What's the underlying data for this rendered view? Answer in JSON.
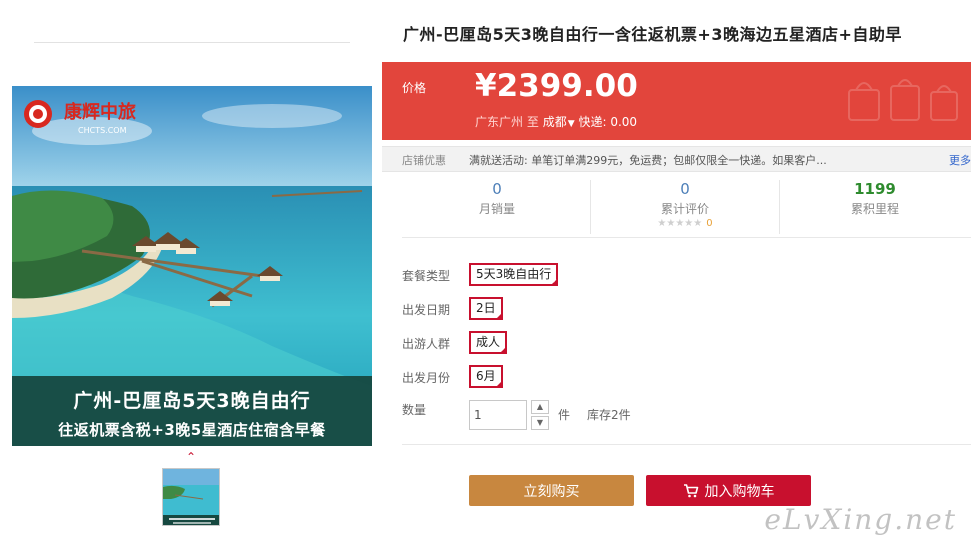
{
  "gallery": {
    "brand_logo_text": "康辉中旅",
    "brand_logo_sub": "CHCTS.COM",
    "banner_line1": "广州-巴厘岛5天3晚自由行",
    "banner_line2": "往返机票含税+3晚5星酒店住宿含早餐",
    "thumb_nav_symbol": "⌃"
  },
  "product": {
    "title": "广州-巴厘岛5天3晚自由行一含往返机票+3晚海边五星酒店+自助早"
  },
  "price": {
    "label": "价格",
    "value": "¥2399.00",
    "from": "广东广州",
    "to_word": "至",
    "destination": "成都",
    "shipping_label": "快递:",
    "shipping_value": "0.00"
  },
  "promo": {
    "label": "店铺优惠",
    "text": "满就送活动: 单笔订单满299元，免运费；包邮仅限全一快递。如果客户...",
    "more": "更多"
  },
  "stats": {
    "monthly_sales": {
      "value": "0",
      "label": "月销量"
    },
    "reviews": {
      "value": "0",
      "label": "累计评价",
      "stars": "★★★★★",
      "star_count": "0"
    },
    "points": {
      "value": "1199",
      "label": "累积里程"
    }
  },
  "options": [
    {
      "label": "套餐类型",
      "value": "5天3晚自由行"
    },
    {
      "label": "出发日期",
      "value": "2日"
    },
    {
      "label": "出游人群",
      "value": "成人"
    },
    {
      "label": "出发月份",
      "value": "6月"
    }
  ],
  "quantity": {
    "label": "数量",
    "value": "1",
    "unit": "件",
    "stock": "库存2件"
  },
  "actions": {
    "buy_now": "立刻购买",
    "add_cart": "加入购物车"
  },
  "watermark": "eLvXing.net",
  "colors": {
    "price_red": "#e2453c",
    "accent_red": "#c8102e",
    "buy_orange": "#c8873f",
    "stat_blue": "#4d7fb8",
    "stat_green": "#2e8b2e"
  }
}
